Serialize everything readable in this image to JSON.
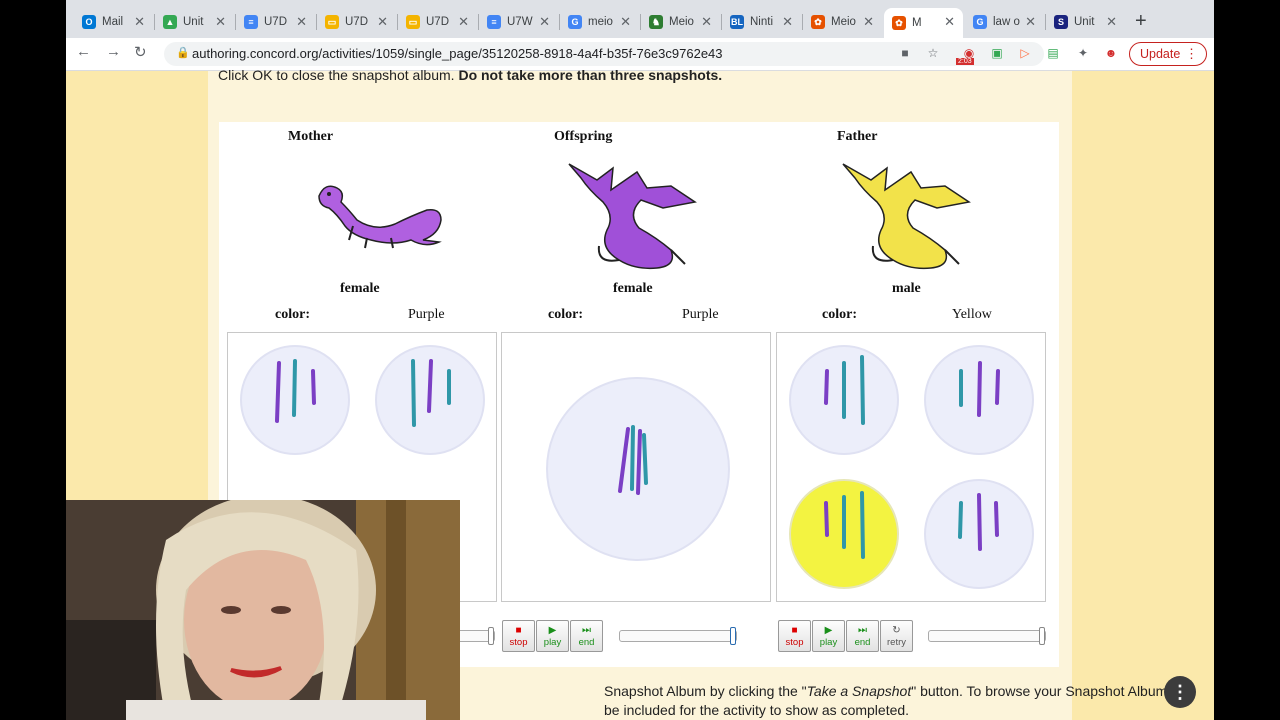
{
  "browser": {
    "tabs": [
      {
        "title": "Mail",
        "icon": "outlook-icon",
        "color": "#0078d4",
        "glyph": "O"
      },
      {
        "title": "Unit",
        "icon": "google-drive-icon",
        "color": "#34a853",
        "glyph": "▲"
      },
      {
        "title": "U7D",
        "icon": "google-docs-icon",
        "color": "#4285f4",
        "glyph": "≡"
      },
      {
        "title": "U7D",
        "icon": "google-slides-icon",
        "color": "#f4b400",
        "glyph": "▭"
      },
      {
        "title": "U7D",
        "icon": "google-slides-icon",
        "color": "#f4b400",
        "glyph": "▭"
      },
      {
        "title": "U7W",
        "icon": "google-docs-icon",
        "color": "#4285f4",
        "glyph": "≡"
      },
      {
        "title": "meio",
        "icon": "google-icon",
        "color": "#4285f4",
        "glyph": "G"
      },
      {
        "title": "Meio",
        "icon": "dragon-icon",
        "color": "#2e7d32",
        "glyph": "♞"
      },
      {
        "title": "Ninti",
        "icon": "bl-icon",
        "color": "#1565c0",
        "glyph": "BL"
      },
      {
        "title": "Meio",
        "icon": "concord-icon",
        "color": "#e65100",
        "glyph": "✿"
      },
      {
        "title": "M",
        "icon": "concord-icon",
        "color": "#e65100",
        "glyph": "✿"
      },
      {
        "title": "law o",
        "icon": "google-icon",
        "color": "#4285f4",
        "glyph": "G"
      },
      {
        "title": "Unit",
        "icon": "schoology-icon",
        "color": "#1a237e",
        "glyph": "S"
      }
    ],
    "url": "authoring.concord.org/activities/1059/single_page/35120258-8918-4a4f-b35f-76e3c9762e43",
    "update_label": "Update",
    "badge_time": "2:03"
  },
  "page": {
    "top_instruction_plain": "Click OK to close the snapshot album. ",
    "top_instruction_bold": "Do not take more than three snapshots.",
    "bottom_line1_prefix": "Snapshot Album by clicking the \"",
    "bottom_line1_italic": "Take a Snapshot",
    "bottom_line1_suffix": "\" button.  To browse your Snapshot Album,",
    "bottom_line2": "be included for the activity to show as completed."
  },
  "sim": {
    "mother": {
      "title": "Mother",
      "sex": "female",
      "color_label": "color:",
      "color": "Purple"
    },
    "offspring": {
      "title": "Offspring",
      "sex": "female",
      "color_label": "color:",
      "color": "Purple"
    },
    "father": {
      "title": "Father",
      "sex": "male",
      "color_label": "color:",
      "color": "Yellow"
    },
    "controls": {
      "stop": "stop",
      "play": "play",
      "end": "end",
      "retry": "retry"
    },
    "colors": {
      "purple_chrom": "#7b3fc4",
      "teal_chrom": "#2f97a8",
      "cell": "#eceefa",
      "yellow_cell": "#f3f341"
    }
  }
}
